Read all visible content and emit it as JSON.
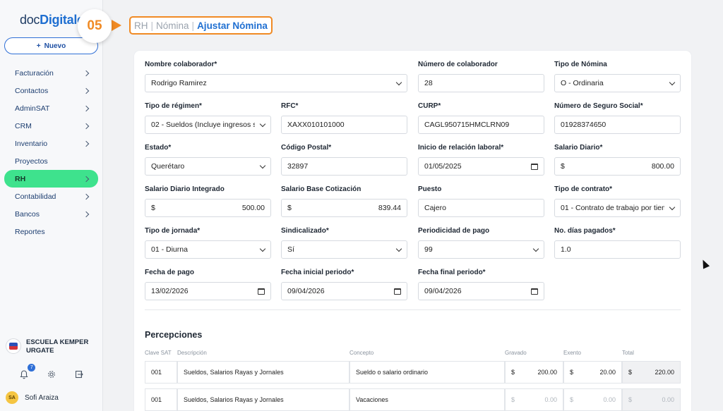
{
  "sidebar": {
    "logo_part1": "doc",
    "logo_part2": "Digitales",
    "step_badge": "05",
    "new_button": "Nuevo",
    "items": [
      {
        "label": "Facturación",
        "chevron": true
      },
      {
        "label": "Contactos",
        "chevron": true
      },
      {
        "label": "AdminSAT",
        "chevron": true
      },
      {
        "label": "CRM",
        "chevron": true
      },
      {
        "label": "Inventario",
        "chevron": true
      },
      {
        "label": "Proyectos",
        "chevron": false
      },
      {
        "label": "RH",
        "chevron": true,
        "active": true
      },
      {
        "label": "Contabilidad",
        "chevron": true
      },
      {
        "label": "Bancos",
        "chevron": true
      },
      {
        "label": "Reportes",
        "chevron": false
      }
    ],
    "org_name": "ESCUELA KEMPER URGATE",
    "notification_count": "7",
    "user_initials": "SA",
    "user_name": "Sofi Araiza"
  },
  "breadcrumb": {
    "part1": "RH",
    "part2": "Nómina",
    "current": "Ajustar Nómina",
    "sep": "|"
  },
  "form": {
    "nombre_colaborador": {
      "label": "Nombre colaborador*",
      "value": "Rodrigo Ramirez"
    },
    "numero_colaborador": {
      "label": "Número de colaborador",
      "value": "28"
    },
    "tipo_nomina": {
      "label": "Tipo de Nómina",
      "value": "O - Ordinaria"
    },
    "tipo_regimen": {
      "label": "Tipo de régimen*",
      "value": "02 - Sueldos (Incluye ingresos se..."
    },
    "rfc": {
      "label": "RFC*",
      "value": "XAXX010101000"
    },
    "curp": {
      "label": "CURP*",
      "value": "CAGL950715HMCLRN09"
    },
    "nss": {
      "label": "Número de Seguro Social*",
      "value": "01928374650"
    },
    "estado": {
      "label": "Estado*",
      "value": "Querétaro"
    },
    "codigo_postal": {
      "label": "Código Postal*",
      "value": "32897"
    },
    "inicio_relacion": {
      "label": "Inicio de relación laboral*",
      "value": "01/05/2025"
    },
    "salario_diario": {
      "label": "Salario Diario*",
      "value": "800.00"
    },
    "sdi": {
      "label": "Salario Diario Integrado",
      "value": "500.00"
    },
    "sbc": {
      "label": "Salario Base Cotización",
      "value": "839.44"
    },
    "puesto": {
      "label": "Puesto",
      "value": "Cajero"
    },
    "tipo_contrato": {
      "label": "Tipo de contrato*",
      "value": "01 - Contrato de trabajo por tiem..."
    },
    "tipo_jornada": {
      "label": "Tipo de jornada*",
      "value": "01 - Diurna"
    },
    "sindicalizado": {
      "label": "Sindicalizado*",
      "value": "Sí"
    },
    "periodicidad": {
      "label": "Periodicidad de pago",
      "value": "99"
    },
    "dias_pagados": {
      "label": "No. días pagados*",
      "value": "1.0"
    },
    "fecha_pago": {
      "label": "Fecha de pago",
      "value": "13/02/2026"
    },
    "fecha_inicial": {
      "label": "Fecha inicial periodo*",
      "value": "09/04/2026"
    },
    "fecha_final": {
      "label": "Fecha final periodo*",
      "value": "09/04/2026"
    },
    "currency": "$"
  },
  "percepciones": {
    "title": "Percepciones",
    "headers": [
      "Clave SAT",
      "Descripción",
      "Concepto",
      "Gravado",
      "Exento",
      "Total"
    ],
    "rows": [
      {
        "clave": "001",
        "descripcion": "Sueldos, Salarios Rayas y Jornales",
        "concepto": "Sueldo o salario ordinario",
        "gravado": "200.00",
        "exento": "20.00",
        "total": "220.00"
      },
      {
        "clave": "001",
        "descripcion": "Sueldos, Salarios Rayas y Jornales",
        "concepto": "Vacaciones",
        "gravado": "0.00",
        "exento": "0.00",
        "total": "0.00"
      }
    ]
  }
}
